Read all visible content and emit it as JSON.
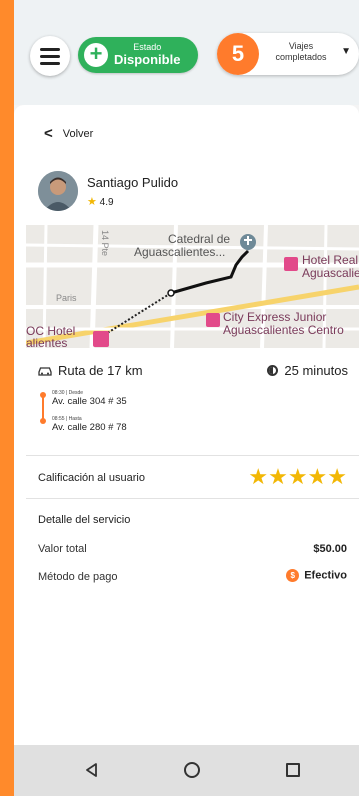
{
  "header": {
    "status_small": "Estado",
    "status_big": "Disponible",
    "trips_count": "5",
    "trips_label_line1": "Viajes",
    "trips_label_line2": "completados"
  },
  "back_label": "Volver",
  "user": {
    "name": "Santiago Pulido",
    "rating": "4.9"
  },
  "map": {
    "label_cathedral_1": "Catedral de",
    "label_cathedral_2": "Aguascalientes...",
    "label_hotel_real_1": "Hotel Real",
    "label_hotel_real_2": "Aguascalie",
    "label_city_express_1": "City Express Junior",
    "label_city_express_2": "Aguascalientes Centro",
    "label_hotel_left_1": "OC Hotel",
    "label_hotel_left_2": "alientes",
    "label_street_paris": "Paris",
    "label_street_pte": "14 Pte"
  },
  "route": {
    "distance": "Ruta de 17 km",
    "duration": "25 minutos",
    "from_time": "08:30 | Desde",
    "from_addr": "Av. calle 304 # 35",
    "to_time": "08:55 | Hasta",
    "to_addr": "Av. calle 280 # 78"
  },
  "rating_section": {
    "label": "Calificación al usuario",
    "stars": "★★★★★"
  },
  "details": {
    "title": "Detalle del servicio",
    "total_label": "Valor total",
    "total_value": "$50.00",
    "payment_label": "Método de pago",
    "payment_value": "Efectivo"
  },
  "colors": {
    "accent": "#ff7b2c",
    "available": "#2fb15b",
    "star": "#f2b705"
  }
}
